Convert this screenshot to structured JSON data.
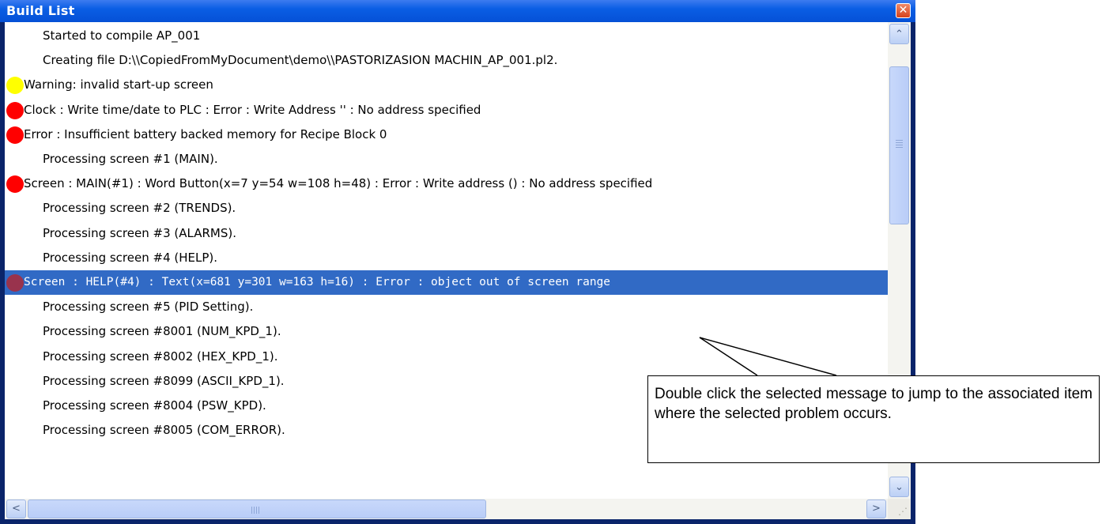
{
  "window": {
    "title": "Build List",
    "close_glyph": "✕"
  },
  "messages": [
    {
      "text": "Started to compile AP_001",
      "level": "info"
    },
    {
      "text": "Creating file D:\\\\CopiedFromMyDocument\\demo\\\\PASTORIZASION MACHIN_AP_001.pl2.",
      "level": "info"
    },
    {
      "text": "Warning: invalid start-up screen",
      "level": "warning"
    },
    {
      "text": "Clock : Write time/date to PLC : Error : Write Address '' : No address specified",
      "level": "error"
    },
    {
      "text": "Error : Insufficient battery backed memory for Recipe Block 0",
      "level": "error"
    },
    {
      "text": "Processing screen #1 (MAIN).",
      "level": "info"
    },
    {
      "text": "Screen : MAIN(#1) : Word Button(x=7 y=54 w=108 h=48) : Error : Write address () : No address specified",
      "level": "error"
    },
    {
      "text": "Processing screen #2 (TRENDS).",
      "level": "info"
    },
    {
      "text": "Processing screen #3 (ALARMS).",
      "level": "info"
    },
    {
      "text": "Processing screen #4 (HELP).",
      "level": "info"
    },
    {
      "text": "Screen : HELP(#4) : Text(x=681 y=301 w=163 h=16) : Error : object out of screen range",
      "level": "error-selected",
      "selected": true
    },
    {
      "text": "Processing screen #5 (PID Setting).",
      "level": "info"
    },
    {
      "text": "Processing screen #8001 (NUM_KPD_1).",
      "level": "info"
    },
    {
      "text": "Processing screen #8002 (HEX_KPD_1).",
      "level": "info"
    },
    {
      "text": "Processing screen #8099 (ASCII_KPD_1).",
      "level": "info"
    },
    {
      "text": "Processing screen #8004 (PSW_KPD).",
      "level": "info"
    },
    {
      "text": "Processing screen #8005 (COM_ERROR).",
      "level": "info"
    }
  ],
  "scrollbars": {
    "up_glyph": "⌃",
    "down_glyph": "⌄",
    "left_glyph": "<",
    "right_glyph": ">"
  },
  "callout": {
    "text": "Double click the selected message to jump to the associated item where the selected problem occurs."
  },
  "colors": {
    "warning_dot": "#ffff00",
    "error_dot": "#ff0000",
    "selected_dot": "#99334d",
    "selection_bg": "#316ac5"
  }
}
